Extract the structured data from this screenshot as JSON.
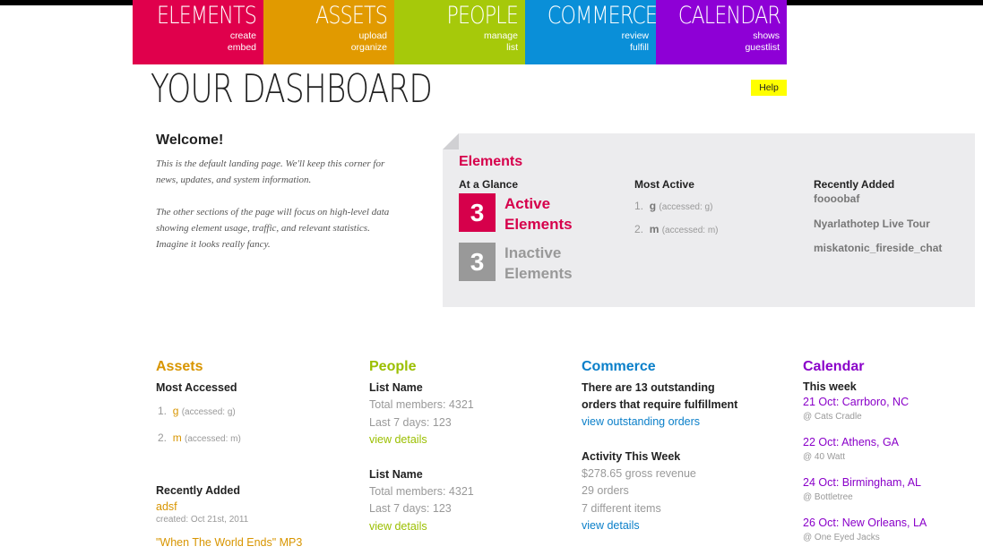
{
  "nav": [
    {
      "title": "Elements",
      "sub1": "create",
      "sub2": "embed",
      "color": "#e0004c"
    },
    {
      "title": "Assets",
      "sub1": "upload",
      "sub2": "organize",
      "color": "#e19a00"
    },
    {
      "title": "People",
      "sub1": "manage",
      "sub2": "list",
      "color": "#a6c90a"
    },
    {
      "title": "Commerce",
      "sub1": "review",
      "sub2": "fulfill",
      "color": "#0a8fd8"
    },
    {
      "title": "Calendar",
      "sub1": "shows",
      "sub2": "guestlist",
      "color": "#8e00d6"
    }
  ],
  "page_title": "YOUR DASHBOARD",
  "help_label": "Help",
  "welcome": {
    "title": "Welcome!",
    "p1": "This is the default landing page. We'll keep this corner for news, updates, and system information.",
    "p2": "The other sections of the page will focus on high-level data showing element usage, traffic, and relevant statistics. Imagine it looks really fancy."
  },
  "elements_panel": {
    "title": "Elements",
    "glance_heading": "At a Glance",
    "active_count": "3",
    "active_label_1": "Active",
    "active_label_2": "Elements",
    "inactive_count": "3",
    "inactive_label_1": "Inactive",
    "inactive_label_2": "Elements",
    "most_active_heading": "Most Active",
    "most_active": [
      {
        "num": "1.",
        "name": "g",
        "accessed": "(accessed: g)"
      },
      {
        "num": "2.",
        "name": "m",
        "accessed": "(accessed: m)"
      }
    ],
    "recently_added_heading": "Recently Added",
    "recently_added": [
      "foooobaf",
      "Nyarlathotep Live Tour",
      "miskatonic_fireside_chat"
    ]
  },
  "assets": {
    "title": "Assets",
    "most_accessed_heading": "Most Accessed",
    "most_accessed": [
      {
        "num": "1.",
        "name": "g",
        "accessed": "(accessed: g)"
      },
      {
        "num": "2.",
        "name": "m",
        "accessed": "(accessed: m)"
      }
    ],
    "recently_added_heading": "Recently Added",
    "recent_name": "adsf",
    "recent_created": "created: Oct 21st, 2011",
    "recent_link": "\"When The World Ends\" MP3"
  },
  "people": {
    "title": "People",
    "lists": [
      {
        "name": "List Name",
        "members": "Total members: 4321",
        "last7": "Last 7 days: 123",
        "link": "view details"
      },
      {
        "name": "List Name",
        "members": "Total members: 4321",
        "last7": "Last 7 days: 123",
        "link": "view details"
      }
    ]
  },
  "commerce": {
    "title": "Commerce",
    "notice_line1": "There are 13 outstanding",
    "notice_line2": "orders that require fulfillment",
    "orders_link": "view outstanding orders",
    "activity_heading": "Activity This Week",
    "revenue": "$278.65 gross revenue",
    "orders": "29 orders",
    "items": "7 different items",
    "details_link": "view details"
  },
  "calendar": {
    "title": "Calendar",
    "week_heading": "This week",
    "events": [
      {
        "date": "21 Oct: Carrboro, NC",
        "venue": "@ Cats Cradle"
      },
      {
        "date": "22 Oct: Athens, GA",
        "venue": "@ 40 Watt"
      },
      {
        "date": "24 Oct: Birmingham, AL",
        "venue": "@ Bottletree"
      },
      {
        "date": "26 Oct: New Orleans, LA",
        "venue": "@ One Eyed Jacks"
      }
    ]
  },
  "colors": {
    "elements": "#d6004b",
    "assets": "#d89500",
    "people": "#9bbf00",
    "commerce": "#0a7fc9",
    "calendar": "#8a00c9",
    "inactive_gray": "#999999"
  }
}
